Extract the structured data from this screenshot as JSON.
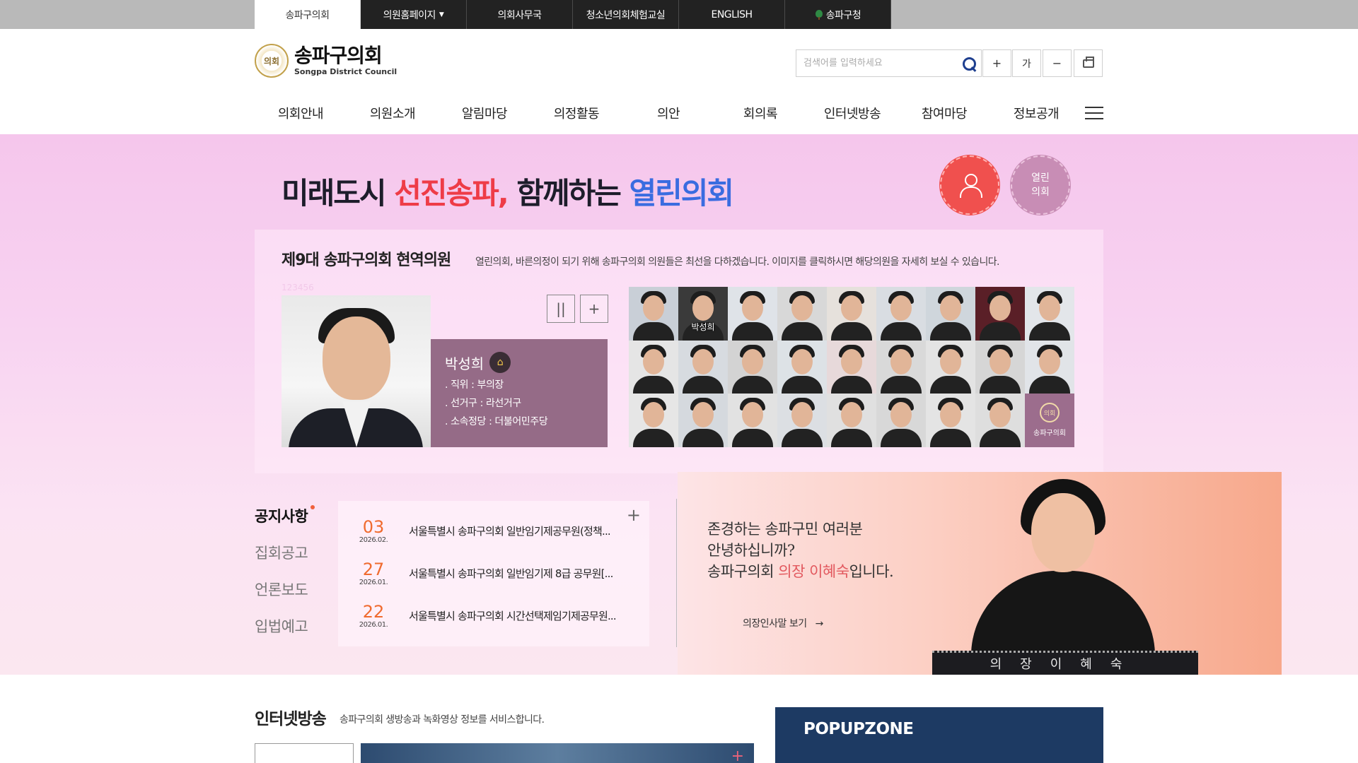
{
  "topbar": {
    "tabs": [
      {
        "label": "송파구의회",
        "active": true
      },
      {
        "label": "의원홈페이지",
        "caret": "▼"
      },
      {
        "label": "의회사무국"
      },
      {
        "label": "청소년의회체험교실"
      },
      {
        "label": "ENGLISH"
      },
      {
        "label": "송파구청"
      }
    ]
  },
  "header": {
    "logo_ko": "송파구의회",
    "logo_en": "Songpa District Council",
    "emblem_text": "의회",
    "search_placeholder": "검색어를 입력하세요",
    "tools": {
      "zoom_in": "+",
      "font": "가",
      "zoom_out": "−"
    }
  },
  "gnb": {
    "items": [
      "의회안내",
      "의원소개",
      "알림마당",
      "의정활동",
      "의안",
      "회의록",
      "인터넷방송",
      "참여마당",
      "정보공개"
    ]
  },
  "hero": {
    "slogan": {
      "part1": "미래도시 ",
      "part2": "선진송파,",
      "part3": " 함께하는 ",
      "part4": "열린의회"
    },
    "open_button": "열린\n의회"
  },
  "members": {
    "title": "제9대 송파구의회 현역의원",
    "desc": "열린의회, 바른의정이 되기 위해 송파구의회 의원들은 최선을 다하겠습니다. 이미지를 클릭하시면 해당의원을 자세히 보실 수 있습니다.",
    "num": "123456",
    "featured": {
      "name": "박성희",
      "lines": [
        ". 직위 : 부의장",
        ". 선거구 : 라선거구",
        ". 소속정당 : 더불어민주당"
      ]
    },
    "controls": {
      "pause": "||",
      "more": "+"
    },
    "grid_hover_label": "박성희",
    "council_label": "송파구의회",
    "mini_emblem": "의회"
  },
  "notices": {
    "tabs": [
      "공지사항",
      "집회공고",
      "언론보도",
      "입법예고"
    ],
    "more": "+",
    "items": [
      {
        "day": "03",
        "ym": "2026.02.",
        "text": "서울특별시 송파구의회 일반임기제공무원(정책..."
      },
      {
        "day": "27",
        "ym": "2026.01.",
        "text": "서울특별시 송파구의회 일반임기제 8급 공무원[..."
      },
      {
        "day": "22",
        "ym": "2026.01.",
        "text": "서울특별시 송파구의회 시간선택제임기제공무원..."
      }
    ]
  },
  "chair": {
    "line1": "존경하는 송파구민 여러분",
    "line2": "안녕하십니까?",
    "line3a": "송파구의회 ",
    "line3b": "의장 이혜숙",
    "line3c": "입니다.",
    "more": "의장인사말 보기",
    "arrow": "→",
    "desk": "의장이혜숙"
  },
  "broadcast": {
    "title": "인터넷방송",
    "desc": "송파구의회 생방송과 녹화영상 정보를 서비스합니다.",
    "plus": "+"
  },
  "popup": {
    "title": "POPUPZONE"
  },
  "colors": {
    "accent_red": "#ee3c47",
    "accent_blue": "#3a6ce0",
    "card_purple": "#956b87",
    "popup_navy": "#1d3a63"
  }
}
